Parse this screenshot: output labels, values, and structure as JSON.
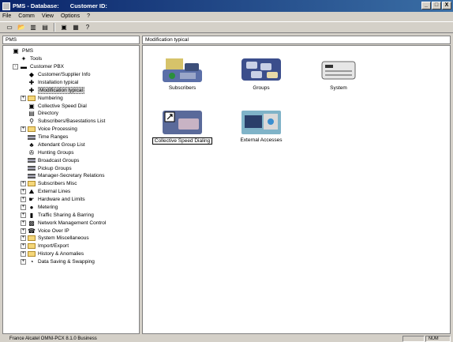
{
  "window": {
    "app_title": "PMS - Database:",
    "context_title": "Customer ID:",
    "controls": [
      "_",
      "□",
      "X"
    ]
  },
  "menu": [
    "File",
    "Comm",
    "View",
    "Options",
    "?"
  ],
  "toolbar": {
    "icons": [
      "new-icon",
      "open-icon",
      "save-icon",
      "save-as-icon",
      "print-icon",
      "book-icon",
      "help-icon"
    ],
    "glyphs": [
      "▭",
      "📂",
      "▥",
      "▤",
      "▣",
      "▦",
      "?"
    ]
  },
  "left_pane": {
    "header": "PMS"
  },
  "tree": [
    {
      "label": "PMS",
      "icon": "pms-icon",
      "level": 0,
      "expander": "",
      "glyph": "▣"
    },
    {
      "label": "Tools",
      "icon": "tools-icon",
      "level": 1,
      "expander": "",
      "glyph": "✦"
    },
    {
      "label": "Customer PBX",
      "icon": "pbx-icon",
      "level": 1,
      "expander": "-",
      "glyph": "▬"
    },
    {
      "label": "Customer/Supplier Info",
      "icon": "info-icon",
      "level": 2,
      "expander": "",
      "glyph": "◆"
    },
    {
      "label": "Installation typical",
      "icon": "installation-icon",
      "level": 2,
      "expander": "",
      "glyph": "✚"
    },
    {
      "label": "Modification typical",
      "icon": "modification-icon",
      "level": 2,
      "expander": "",
      "glyph": "✚",
      "selected": true
    },
    {
      "label": "Numbering",
      "icon": "folder-icon",
      "level": 2,
      "expander": "+",
      "glyph": ""
    },
    {
      "label": "Collective Speed Dial",
      "icon": "speed-dial-icon",
      "level": 2,
      "expander": "",
      "glyph": "▣"
    },
    {
      "label": "Directory",
      "icon": "directory-icon",
      "level": 2,
      "expander": "",
      "glyph": "▤"
    },
    {
      "label": "Subscribers/Basestations List",
      "icon": "subscribers-list-icon",
      "level": 2,
      "expander": "",
      "glyph": "⚲"
    },
    {
      "label": "Voice Processing",
      "icon": "folder-icon",
      "level": 2,
      "expander": "+",
      "glyph": ""
    },
    {
      "label": "Time Ranges",
      "icon": "list-icon",
      "level": 2,
      "expander": "",
      "glyph": ""
    },
    {
      "label": "Attendant Group List",
      "icon": "attendant-icon",
      "level": 2,
      "expander": "",
      "glyph": "♣"
    },
    {
      "label": "Hunting Groups",
      "icon": "hunting-icon",
      "level": 2,
      "expander": "",
      "glyph": "✇"
    },
    {
      "label": "Broadcast Groups",
      "icon": "list-icon",
      "level": 2,
      "expander": "",
      "glyph": ""
    },
    {
      "label": "Pickup Groups",
      "icon": "list-icon",
      "level": 2,
      "expander": "",
      "glyph": ""
    },
    {
      "label": "Manager-Secretary Relations",
      "icon": "list-icon",
      "level": 2,
      "expander": "",
      "glyph": ""
    },
    {
      "label": "Subscribers Misc",
      "icon": "folder-icon",
      "level": 2,
      "expander": "+",
      "glyph": ""
    },
    {
      "label": "External Lines",
      "icon": "external-lines-icon",
      "level": 2,
      "expander": "+",
      "glyph": "⛰"
    },
    {
      "label": "Hardware and Limits",
      "icon": "hardware-icon",
      "level": 2,
      "expander": "+",
      "glyph": "☛"
    },
    {
      "label": "Metering",
      "icon": "metering-icon",
      "level": 2,
      "expander": "+",
      "glyph": "●"
    },
    {
      "label": "Traffic Sharing & Barring",
      "icon": "traffic-icon",
      "level": 2,
      "expander": "+",
      "glyph": "▮"
    },
    {
      "label": "Network Management Control",
      "icon": "network-icon",
      "level": 2,
      "expander": "+",
      "glyph": "▩"
    },
    {
      "label": "Voice Over IP",
      "icon": "voip-icon",
      "level": 2,
      "expander": "+",
      "glyph": "☎"
    },
    {
      "label": "System Miscellaneous",
      "icon": "folder-icon",
      "level": 2,
      "expander": "+",
      "glyph": ""
    },
    {
      "label": "Import/Export",
      "icon": "folder-icon",
      "level": 2,
      "expander": "+",
      "glyph": ""
    },
    {
      "label": "History & Anomalies",
      "icon": "folder-icon",
      "level": 2,
      "expander": "+",
      "glyph": ""
    },
    {
      "label": "Data Saving & Swapping",
      "icon": "data-saving-icon",
      "level": 2,
      "expander": "+",
      "glyph": "◔"
    }
  ],
  "right_pane": {
    "header": "Modification typical",
    "items": [
      {
        "label": "Subscribers",
        "icon": "subscribers-icon",
        "focused": false
      },
      {
        "label": "Groups",
        "icon": "groups-icon",
        "focused": false
      },
      {
        "label": "System",
        "icon": "system-icon",
        "focused": false
      },
      {
        "label": "Collective Speed Dialing",
        "icon": "collective-speed-dialing-icon",
        "focused": true
      },
      {
        "label": "External Accesses",
        "icon": "external-accesses-icon",
        "focused": false
      }
    ]
  },
  "status": {
    "text": "France Alcatel OMNI-PCX 8.1.0 Business",
    "indicator": "NUM"
  },
  "colors": {
    "titlebar_start": "#0a246a",
    "titlebar_end": "#3a6ea5",
    "chrome": "#d4d0c8"
  }
}
